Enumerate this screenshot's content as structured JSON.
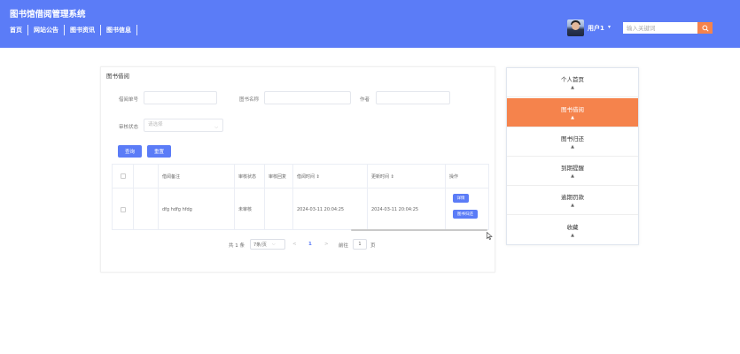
{
  "header": {
    "site_title": "图书馆借阅管理系统",
    "nav": [
      "首页",
      "网站公告",
      "图书资讯",
      "图书信息"
    ],
    "user_name": "用户1",
    "user_arrow": "▾",
    "search_placeholder": "输入关键词",
    "search_icon": "search-icon"
  },
  "main": {
    "title": "图书借阅",
    "filters": {
      "borrow_no_label": "借阅单号",
      "book_name_label": "图书名称",
      "author_label": "作者",
      "audit_status_label": "审核状态",
      "audit_status_placeholder": "请选择"
    },
    "buttons": {
      "search": "查询",
      "reset": "重置"
    },
    "table": {
      "headers": [
        "",
        "",
        "借阅备注",
        "审核状态",
        "审核回复",
        "借阅时间 ⇕",
        "更新时间 ⇕",
        "操作"
      ],
      "rows": [
        {
          "remark": "dfg hdfg hfdg",
          "audit_status": "未审核",
          "audit_reply": "",
          "borrow_time": "2024-03-11 20:04:25",
          "update_time": "2024-03-11 20:04:25",
          "ops": [
            "详情",
            "图书归还"
          ]
        }
      ]
    },
    "pagination": {
      "total": "共 1 条",
      "page_size": "7条/页",
      "prev": "<",
      "current": "1",
      "next": ">",
      "goto_label": "前往",
      "goto_value": "1",
      "page_suffix": "页"
    }
  },
  "side_menu": {
    "items": [
      {
        "label": "个人首页",
        "icon": "▲",
        "active": false
      },
      {
        "label": "图书借阅",
        "icon": "▲",
        "active": true
      },
      {
        "label": "图书归还",
        "icon": "▲",
        "active": false
      },
      {
        "label": "到期提醒",
        "icon": "▲",
        "active": false
      },
      {
        "label": "逾期罚款",
        "icon": "▲",
        "active": false
      },
      {
        "label": "收藏",
        "icon": "▲",
        "active": false
      }
    ]
  },
  "colors": {
    "primary": "#5b7cf7",
    "accent": "#f5834c"
  }
}
